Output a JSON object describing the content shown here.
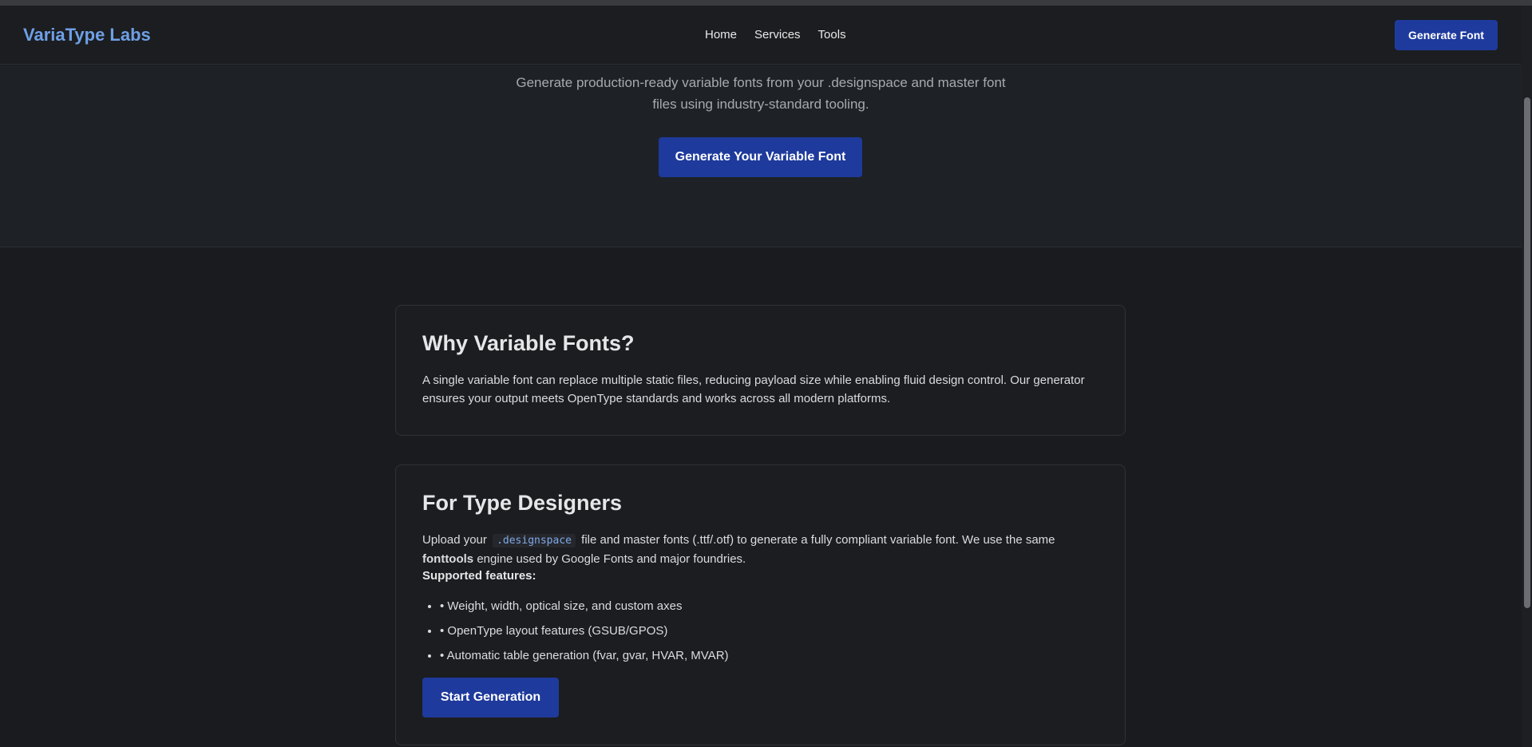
{
  "nav": {
    "brand": "VariaType Labs",
    "links": [
      "Home",
      "Services",
      "Tools"
    ],
    "cta": "Generate Font"
  },
  "hero": {
    "subtitle": "Generate production-ready variable fonts from your .designspace and master font files using industry-standard tooling.",
    "cta": "Generate Your Variable Font"
  },
  "why": {
    "title": "Why Variable Fonts?",
    "body": "A single variable font can replace multiple static files, reducing payload size while enabling fluid design control. Our generator ensures your output meets OpenType standards and works across all modern platforms."
  },
  "designers": {
    "title": "For Type Designers",
    "body_prefix": "Upload your",
    "code": ".designspace",
    "body_middle": "file and master fonts (.ttf/.otf) to generate a fully compliant variable font. We use the same",
    "bold_term": "fonttools",
    "body_suffix": "engine used by Google Fonts and major foundries.",
    "features_label": "Supported features:",
    "features": [
      "• Weight, width, optical size, and custom axes",
      "• OpenType layout features (GSUB/GPOS)",
      "• Automatic table generation (fvar, gvar, HVAR, MVAR)"
    ],
    "cta": "Start Generation"
  },
  "colors": {
    "accent": "#1e3a9c",
    "brand": "#6ea0e6",
    "background": "#1a1b1e"
  }
}
